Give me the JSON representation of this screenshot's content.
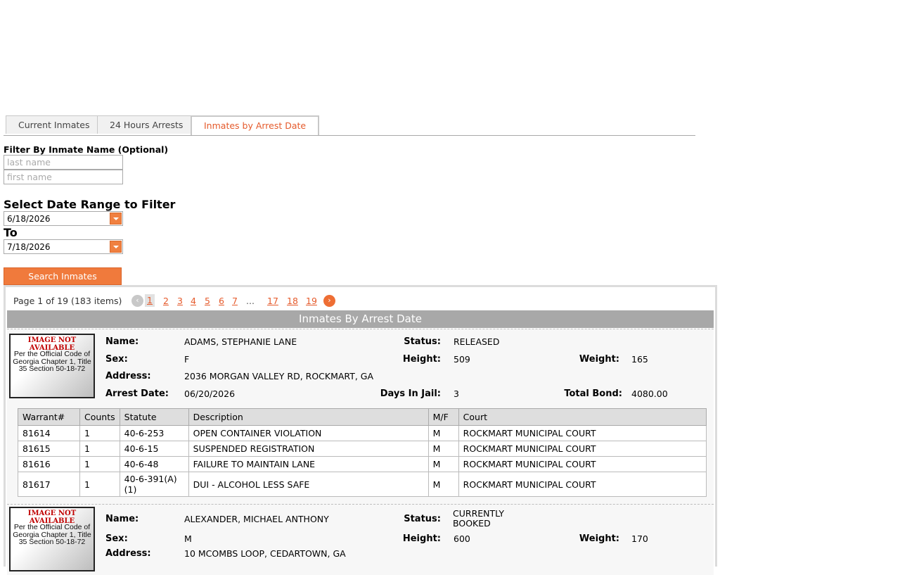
{
  "tabs": [
    {
      "label": "Current Inmates"
    },
    {
      "label": "24 Hours Arrests"
    },
    {
      "label": "Inmates by Arrest Date"
    }
  ],
  "filter": {
    "name_label": "Filter By Inmate Name (Optional)",
    "last_placeholder": "last name",
    "first_placeholder": "first name",
    "range_heading": "Select Date Range to Filter",
    "start_date": "6/18/2026",
    "to_label": "To",
    "end_date": "7/18/2026",
    "search_label": "Search Inmates"
  },
  "pager": {
    "info": "Page 1 of 19 (183 items)",
    "pages": [
      "1",
      "2",
      "3",
      "4",
      "5",
      "6",
      "7",
      "17",
      "18",
      "19"
    ],
    "ellipsis": "..."
  },
  "grid": {
    "title": "Inmates By Arrest Date"
  },
  "photo": {
    "na": "IMAGE NOT AVAILABLE",
    "code": "Per the Official Code of Georgia Chapter 1, Title 35 Section 50-18-72"
  },
  "labels": {
    "name": "Name:",
    "sex": "Sex:",
    "address": "Address:",
    "arrest_date": "Arrest Date:",
    "status": "Status:",
    "height": "Height:",
    "weight": "Weight:",
    "days": "Days In Jail:",
    "bond": "Total Bond:"
  },
  "warrant_headers": [
    "Warrant#",
    "Counts",
    "Statute",
    "Description",
    "M/F",
    "Court"
  ],
  "records": [
    {
      "name": "ADAMS, STEPHANIE LANE",
      "sex": "F",
      "address": "2036 MORGAN VALLEY RD, ROCKMART, GA",
      "arrest_date": "06/20/2026",
      "status": "RELEASED",
      "height": "509",
      "weight": "165",
      "days": "3",
      "bond": "4080.00",
      "warrants": [
        [
          "81614",
          "1",
          "40-6-253",
          "OPEN CONTAINER VIOLATION",
          "M",
          "ROCKMART MUNICIPAL COURT"
        ],
        [
          "81615",
          "1",
          "40-6-15",
          "SUSPENDED REGISTRATION",
          "M",
          "ROCKMART MUNICIPAL COURT"
        ],
        [
          "81616",
          "1",
          "40-6-48",
          "FAILURE TO MAINTAIN LANE",
          "M",
          "ROCKMART MUNICIPAL COURT"
        ],
        [
          "81617",
          "1",
          "40-6-391(A)(1)",
          "DUI - ALCOHOL LESS SAFE",
          "M",
          "ROCKMART MUNICIPAL COURT"
        ]
      ]
    },
    {
      "name": "ALEXANDER, MICHAEL ANTHONY",
      "sex": "M",
      "address": "10 MCOMBS LOOP, CEDARTOWN, GA",
      "status": "CURRENTLY BOOKED",
      "height": "600",
      "weight": "170"
    }
  ]
}
